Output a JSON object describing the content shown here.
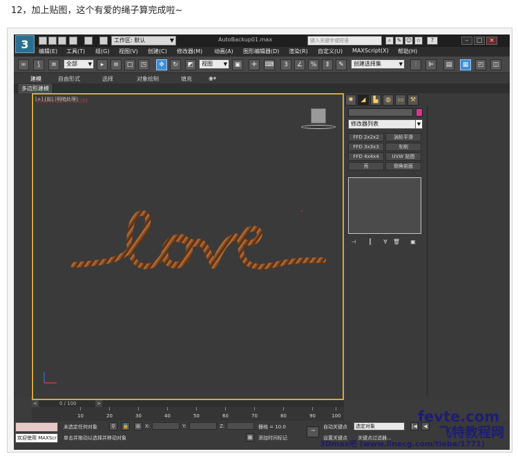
{
  "caption": "12，加上贴图，这个有爱的绳子算完成啦~",
  "titlebar": {
    "logo": "3",
    "workspace": "工作区: 默认",
    "window_title": "AutoBackup01.max",
    "search_placeholder": "键入关键字或短语",
    "help": "?"
  },
  "menu": [
    "编辑(E)",
    "工具(T)",
    "组(G)",
    "视图(V)",
    "创建(C)",
    "修改器(M)",
    "动画(A)",
    "图形编辑器(D)",
    "渲染(R)",
    "自定义(U)",
    "MAXScript(X)",
    "帮助(H)"
  ],
  "toolbar": {
    "filter": "全部",
    "coord_system": "视图",
    "selection_set": "创建选择集",
    "snap_3": "3",
    "snap_percent": "%"
  },
  "ribbon": {
    "tabs": [
      "建模",
      "自由形式",
      "选择",
      "对象绘制",
      "填充"
    ],
    "sub": "多边形建模"
  },
  "viewport": {
    "label": "[+] [前] [明暗处理]",
    "watermark": "WWW.3DXY.COM",
    "text_object": "love",
    "rope_color": "#8a4f26"
  },
  "command_panel": {
    "modifier_list": "修改器列表",
    "buttons": [
      "FFD 2x2x2",
      "涡轮平滑",
      "FFD 3x3x3",
      "车削",
      "FFD 4x4x4",
      "UVW 贴图",
      "壳",
      "倒角剖面"
    ],
    "object_color": "#d63a8c"
  },
  "timeline": {
    "frame_label": "0 / 100",
    "ticks": [
      "10",
      "20",
      "30",
      "40",
      "50",
      "60",
      "70",
      "80",
      "90",
      "100"
    ]
  },
  "status": {
    "maxscript": "欢迎使用 MAXScr",
    "selection": "未选定任何对象",
    "prompt": "单击并拖动以选择并移动对象",
    "x_label": "X:",
    "y_label": "Y:",
    "z_label": "Z:",
    "grid": "栅格 = 10.0",
    "add_time_tag": "添加时间标记",
    "auto_key": "自动关键点",
    "set_key": "设置关键点",
    "selected_object": "选定对象",
    "key_filter": "关键点过滤器..."
  },
  "watermarks": {
    "fevte": "fevte.com",
    "site_cn": "飞特教程网",
    "bottom": "3Dmax吧 (www.linecg.com/tieba/1771)"
  }
}
